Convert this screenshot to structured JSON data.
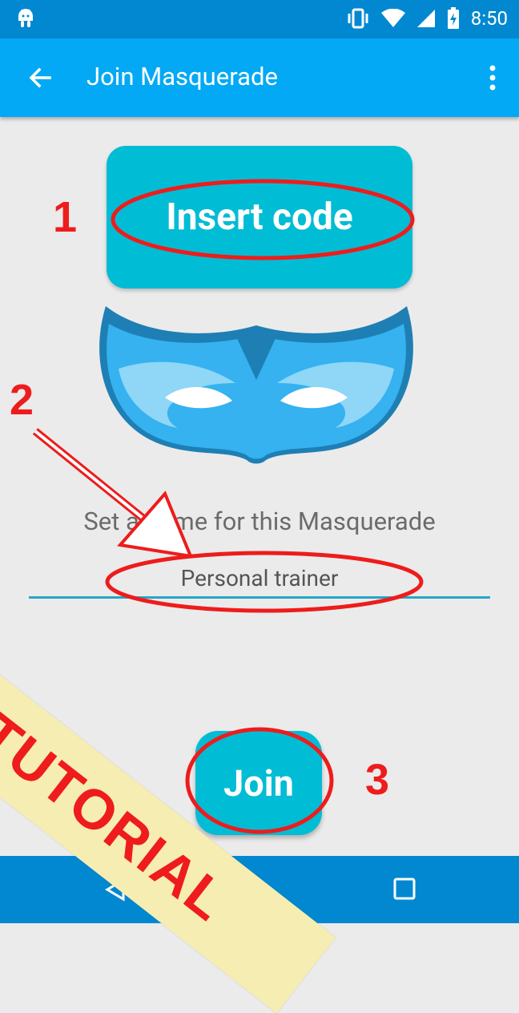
{
  "status_bar": {
    "time": "8:50"
  },
  "app_bar": {
    "title": "Join Masquerade"
  },
  "code_button": {
    "label": "Insert code"
  },
  "name_prompt": "Set a name for this Masquerade",
  "name_input": {
    "value": "Personal trainer"
  },
  "join_button": {
    "label": "Join"
  },
  "tutorial": {
    "steps": [
      "1",
      "2",
      "3"
    ],
    "banner": "TUTORIAL"
  },
  "colors": {
    "status_bar": "#0288d1",
    "app_bar": "#03a9f4",
    "accent_button": "#00bcd4",
    "annotation_red": "#ee1c1c",
    "banner": "#f6edb2"
  }
}
